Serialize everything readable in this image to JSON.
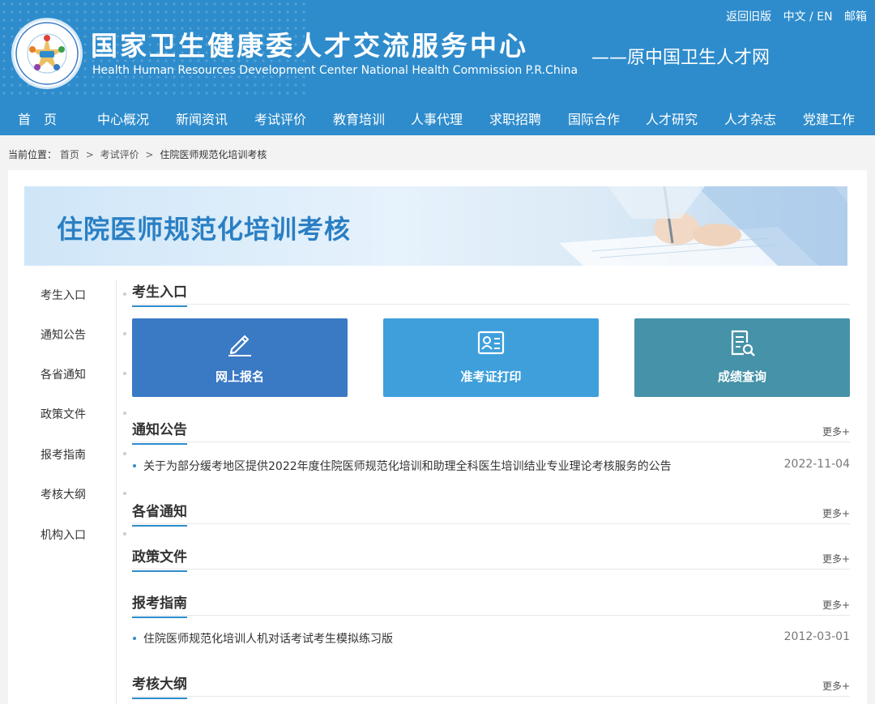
{
  "header": {
    "title": "国家卫生健康委人才交流服务中心",
    "subtitle": "Health Human Resources Development Center National Health Commission P.R.China",
    "slogan": "——原中国卫生人才网",
    "logo_text": "国家卫生健康委人才交流服务中心",
    "top_links": [
      "返回旧版",
      "中文 / EN",
      "邮箱"
    ]
  },
  "nav": [
    "首　页",
    "中心概况",
    "新闻资讯",
    "考试评价",
    "教育培训",
    "人事代理",
    "求职招聘",
    "国际合作",
    "人才研究",
    "人才杂志",
    "党建工作"
  ],
  "breadcrumb": {
    "label": "当前位置：",
    "items": [
      "首页",
      "考试评价",
      "住院医师规范化培训考核"
    ],
    "separator": ">"
  },
  "banner": {
    "title": "住院医师规范化培训考核"
  },
  "side_menu": [
    "考生入口",
    "通知公告",
    "各省通知",
    "政策文件",
    "报考指南",
    "考核大纲",
    "机构入口"
  ],
  "entry": {
    "title": "考生入口",
    "cards": [
      {
        "label": "网上报名",
        "icon": "pencil-icon",
        "color": "#3a79c4"
      },
      {
        "label": "准考证打印",
        "icon": "id-card-icon",
        "color": "#3e9fdb"
      },
      {
        "label": "成绩查询",
        "icon": "document-search-icon",
        "color": "#4592a9"
      }
    ]
  },
  "sections": [
    {
      "title": "通知公告",
      "more": "更多+",
      "items": [
        {
          "text": "关于为部分缓考地区提供2022年度住院医师规范化培训和助理全科医生培训结业专业理论考核服务的公告",
          "date": "2022-11-04"
        }
      ]
    },
    {
      "title": "各省通知",
      "more": "更多+",
      "items": []
    },
    {
      "title": "政策文件",
      "more": "更多+",
      "items": []
    },
    {
      "title": "报考指南",
      "more": "更多+",
      "items": [
        {
          "text": "住院医师规范化培训人机对话考试考生模拟练习版",
          "date": "2012-03-01"
        }
      ]
    },
    {
      "title": "考核大纲",
      "more": "更多+",
      "items": []
    }
  ],
  "colors": {
    "primary": "#2e8ccc",
    "banner_title": "#2a7fc3"
  }
}
